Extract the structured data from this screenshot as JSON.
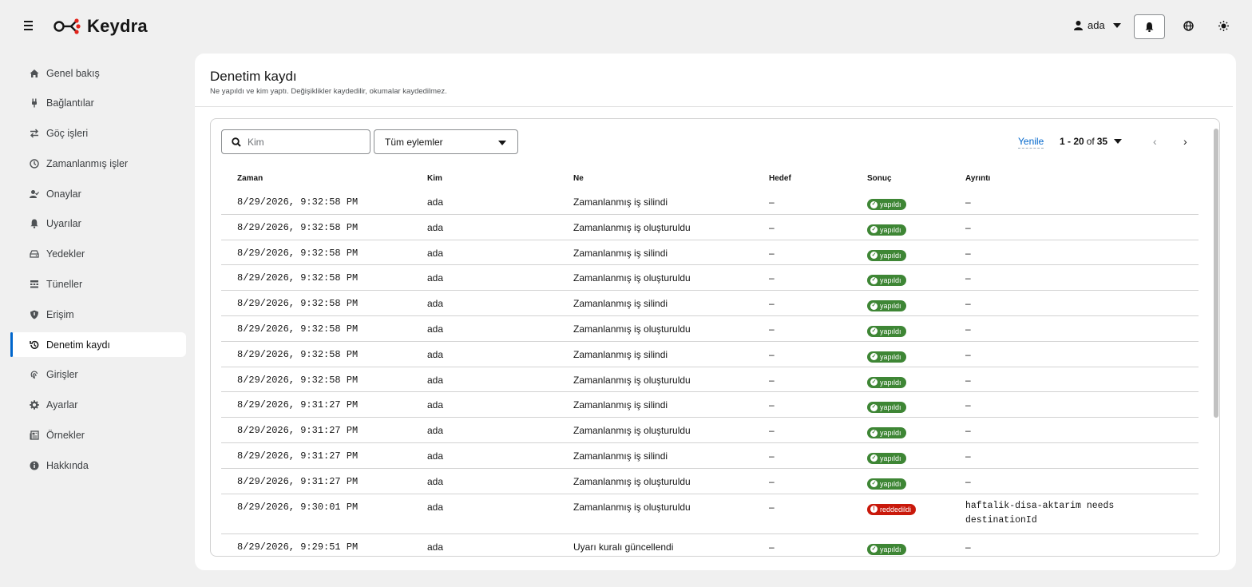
{
  "app": {
    "name": "Keydra"
  },
  "header": {
    "user": "ada"
  },
  "sidebar": {
    "items": [
      {
        "label": "Genel bakış",
        "icon": "home-icon"
      },
      {
        "label": "Bağlantılar",
        "icon": "plug-icon"
      },
      {
        "label": "Göç işleri",
        "icon": "exchange-icon"
      },
      {
        "label": "Zamanlanmış işler",
        "icon": "clock-icon"
      },
      {
        "label": "Onaylar",
        "icon": "user-check-icon"
      },
      {
        "label": "Uyarılar",
        "icon": "bell-icon"
      },
      {
        "label": "Yedekler",
        "icon": "hdd-icon"
      },
      {
        "label": "Tüneller",
        "icon": "network-icon"
      },
      {
        "label": "Erişim",
        "icon": "shield-icon"
      },
      {
        "label": "Denetim kaydı",
        "icon": "history-icon",
        "active": true
      },
      {
        "label": "Girişler",
        "icon": "fingerprint-icon"
      },
      {
        "label": "Ayarlar",
        "icon": "gear-icon"
      },
      {
        "label": "Örnekler",
        "icon": "newspaper-icon"
      },
      {
        "label": "Hakkında",
        "icon": "info-icon"
      }
    ]
  },
  "page": {
    "title": "Denetim kaydı",
    "subtitle": "Ne yapıldı ve kim yaptı. Değişiklikler kaydedilir, okumalar kaydedilmez."
  },
  "toolbar": {
    "search_placeholder": "Kim",
    "action_filter": "Tüm eylemler",
    "refresh": "Yenile",
    "pager_range": "1 - 20",
    "pager_of": "of",
    "pager_total": "35"
  },
  "table": {
    "columns": [
      "Zaman",
      "Kim",
      "Ne",
      "Hedef",
      "Sonuç",
      "Ayrıntı"
    ],
    "rows": [
      {
        "time": "8/29/2026, 9:32:58 PM",
        "who": "ada",
        "what": "Zamanlanmış iş silindi",
        "target": "–",
        "result": "yapıldı",
        "status": "ok",
        "detail": "–"
      },
      {
        "time": "8/29/2026, 9:32:58 PM",
        "who": "ada",
        "what": "Zamanlanmış iş oluşturuldu",
        "target": "–",
        "result": "yapıldı",
        "status": "ok",
        "detail": "–"
      },
      {
        "time": "8/29/2026, 9:32:58 PM",
        "who": "ada",
        "what": "Zamanlanmış iş silindi",
        "target": "–",
        "result": "yapıldı",
        "status": "ok",
        "detail": "–"
      },
      {
        "time": "8/29/2026, 9:32:58 PM",
        "who": "ada",
        "what": "Zamanlanmış iş oluşturuldu",
        "target": "–",
        "result": "yapıldı",
        "status": "ok",
        "detail": "–"
      },
      {
        "time": "8/29/2026, 9:32:58 PM",
        "who": "ada",
        "what": "Zamanlanmış iş silindi",
        "target": "–",
        "result": "yapıldı",
        "status": "ok",
        "detail": "–"
      },
      {
        "time": "8/29/2026, 9:32:58 PM",
        "who": "ada",
        "what": "Zamanlanmış iş oluşturuldu",
        "target": "–",
        "result": "yapıldı",
        "status": "ok",
        "detail": "–"
      },
      {
        "time": "8/29/2026, 9:32:58 PM",
        "who": "ada",
        "what": "Zamanlanmış iş silindi",
        "target": "–",
        "result": "yapıldı",
        "status": "ok",
        "detail": "–"
      },
      {
        "time": "8/29/2026, 9:32:58 PM",
        "who": "ada",
        "what": "Zamanlanmış iş oluşturuldu",
        "target": "–",
        "result": "yapıldı",
        "status": "ok",
        "detail": "–"
      },
      {
        "time": "8/29/2026, 9:31:27 PM",
        "who": "ada",
        "what": "Zamanlanmış iş silindi",
        "target": "–",
        "result": "yapıldı",
        "status": "ok",
        "detail": "–"
      },
      {
        "time": "8/29/2026, 9:31:27 PM",
        "who": "ada",
        "what": "Zamanlanmış iş oluşturuldu",
        "target": "–",
        "result": "yapıldı",
        "status": "ok",
        "detail": "–"
      },
      {
        "time": "8/29/2026, 9:31:27 PM",
        "who": "ada",
        "what": "Zamanlanmış iş silindi",
        "target": "–",
        "result": "yapıldı",
        "status": "ok",
        "detail": "–"
      },
      {
        "time": "8/29/2026, 9:31:27 PM",
        "who": "ada",
        "what": "Zamanlanmış iş oluşturuldu",
        "target": "–",
        "result": "yapıldı",
        "status": "ok",
        "detail": "–"
      },
      {
        "time": "8/29/2026, 9:30:01 PM",
        "who": "ada",
        "what": "Zamanlanmış iş oluşturuldu",
        "target": "–",
        "result": "reddedildi",
        "status": "err",
        "detail": "haftalik-disa-aktarim needs destinationId"
      },
      {
        "time": "8/29/2026, 9:29:51 PM",
        "who": "ada",
        "what": "Uyarı kuralı güncellendi",
        "target": "–",
        "result": "yapıldı",
        "status": "ok",
        "detail": "–"
      }
    ]
  },
  "colors": {
    "accent": "#0066cc",
    "ok": "#3e8635",
    "error": "#c9190b"
  }
}
